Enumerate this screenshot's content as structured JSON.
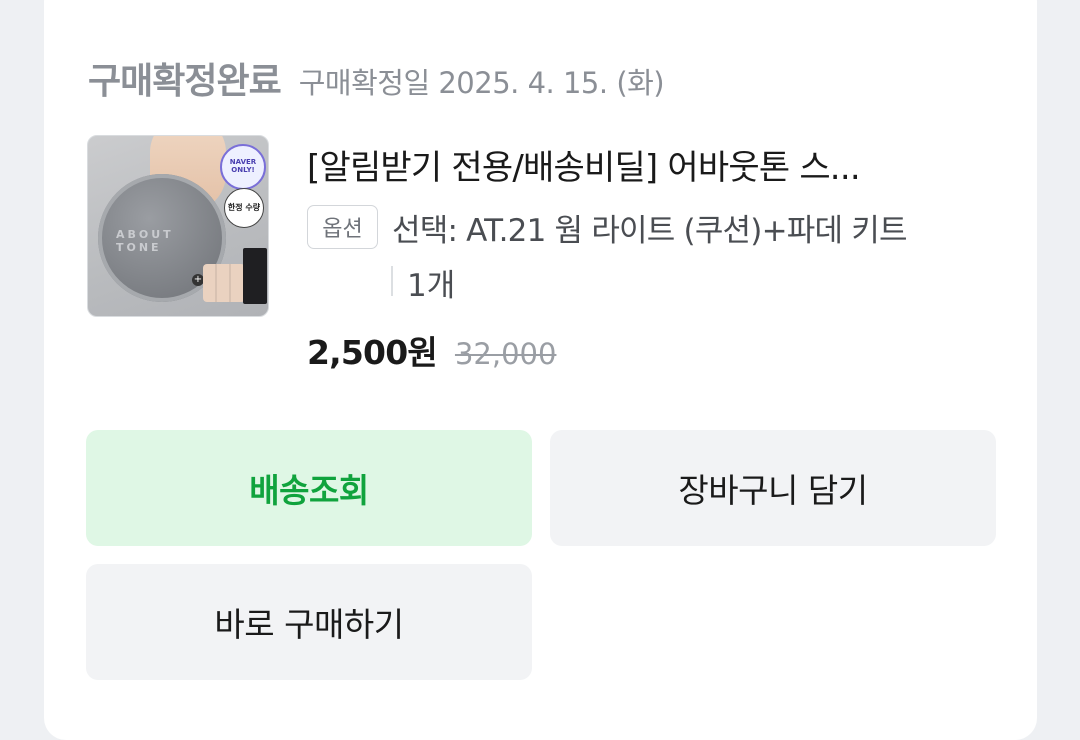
{
  "order": {
    "status": "구매확정완료",
    "confirm_date": "구매확정일 2025. 4. 15. (화)"
  },
  "product": {
    "title": "[알림받기 전용/배송비딜] 어바웃톤 스...",
    "option_label": "옵션",
    "option_value": "선택: AT.21 웜 라이트 (쿠션)+파데 키트",
    "quantity": "1개",
    "price": "2,500원",
    "original_price": "32,000",
    "image": {
      "badge_naver": "NAVER ONLY!",
      "badge_limited": "한정 수량",
      "brand_text": "ABOUT TONE"
    }
  },
  "actions": {
    "track_delivery": "배송조회",
    "add_to_cart": "장바구니 담기",
    "buy_now": "바로 구매하기"
  },
  "colors": {
    "accent_green": "#10a33d",
    "accent_green_bg": "#dff7e5",
    "muted_text": "#8b8f96"
  }
}
